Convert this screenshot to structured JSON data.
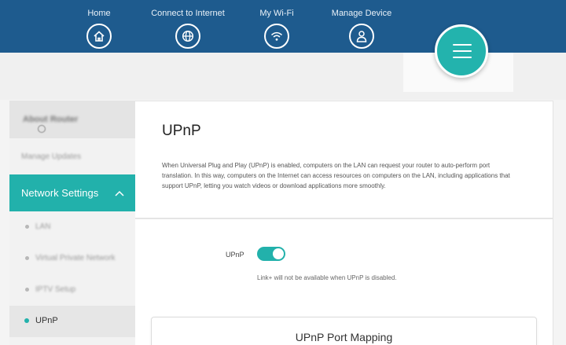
{
  "topnav": {
    "items": [
      {
        "label": "Home",
        "icon": "home-icon"
      },
      {
        "label": "Connect to Internet",
        "icon": "globe-icon"
      },
      {
        "label": "My Wi-Fi",
        "icon": "wifi-icon"
      },
      {
        "label": "Manage Device",
        "icon": "user-icon"
      }
    ],
    "menu_icon": "hamburger-menu-icon"
  },
  "sidebar": {
    "about": "About Router",
    "manage": "Manage Updates",
    "network": {
      "label": "Network Settings",
      "expanded": true
    },
    "subitems": [
      "LAN",
      "Virtual Private Network",
      "IPTV Setup"
    ],
    "active": "UPnP"
  },
  "main": {
    "title": "UPnP",
    "description": "When Universal Plug and Play (UPnP) is enabled, computers on the LAN can request your router to auto-perform port translation. In this way, computers on the Internet can access resources on computers on the LAN, including applications that support UPnP, letting you watch videos or download applications more smoothly.",
    "upnp_label": "UPnP",
    "upnp_enabled": true,
    "note": "Link+ will not be available when UPnP is disabled.",
    "port_mapping_title": "UPnP Port Mapping"
  },
  "colors": {
    "header": "#1e5b8e",
    "accent": "#22b1ab"
  }
}
